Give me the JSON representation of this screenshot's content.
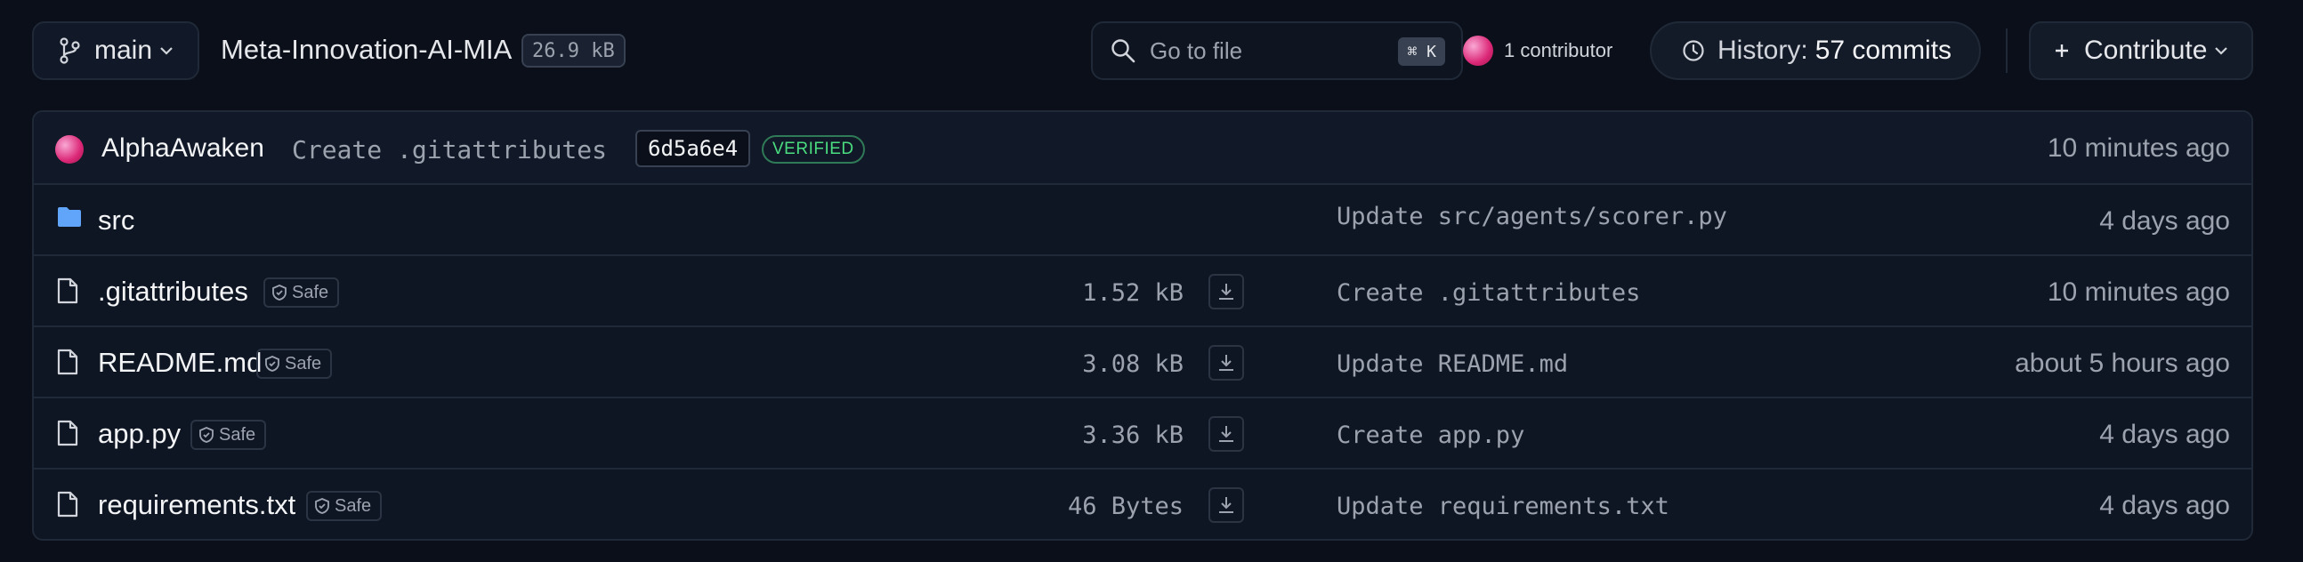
{
  "toolbar": {
    "branch": "main",
    "repo_name": "Meta-Innovation-AI-MIA",
    "repo_size": "26.9 kB",
    "search": {
      "placeholder": "Go to file",
      "shortcut": "⌘ K"
    },
    "contributors": "1 contributor",
    "history_label": "History:",
    "history_count": "57 commits",
    "contribute": "Contribute"
  },
  "last_commit": {
    "author": "AlphaAwaken",
    "message": "Create .gitattributes",
    "sha": "6d5a6e4",
    "badge": "VERIFIED",
    "time": "10 minutes ago"
  },
  "files": [
    {
      "type": "folder",
      "name": "src",
      "safe": "",
      "size": "",
      "commit": "Update src/agents/scorer.py",
      "time": "4 days ago"
    },
    {
      "type": "file",
      "name": ".gitattributes",
      "safe": "Safe",
      "size": "1.52 kB",
      "commit": "Create .gitattributes",
      "time": "10 minutes ago"
    },
    {
      "type": "file",
      "name": "README.md",
      "safe": "Safe",
      "size": "3.08 kB",
      "commit": "Update README.md",
      "time": "about 5 hours ago"
    },
    {
      "type": "file",
      "name": "app.py",
      "safe": "Safe",
      "size": "3.36 kB",
      "commit": "Create app.py",
      "time": "4 days ago"
    },
    {
      "type": "file",
      "name": "requirements.txt",
      "safe": "Safe",
      "size": "46 Bytes",
      "commit": "Update requirements.txt",
      "time": "4 days ago"
    }
  ],
  "colors": {
    "background": "#0b0f19",
    "folder": "#60a5fa",
    "verified": "#4ade80",
    "avatar": "#db2777"
  }
}
